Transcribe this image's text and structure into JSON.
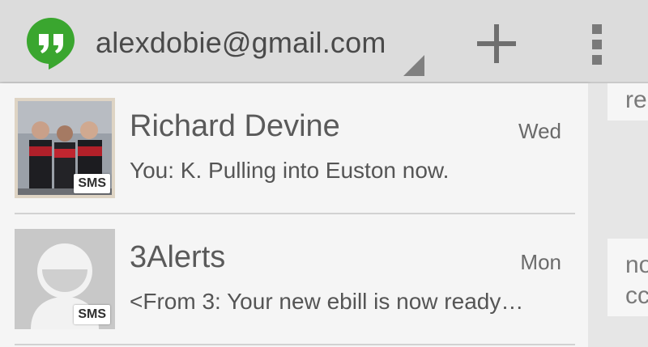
{
  "header": {
    "account_email": "alexdobie@gmail.com",
    "logo_icon": "hangouts-quote-icon",
    "add_icon": "plus-icon",
    "overflow_icon": "overflow-menu-icon",
    "brand_color": "#3aa62f"
  },
  "conversations": [
    {
      "name": "Richard Devine",
      "time": "Wed",
      "snippet": "You: K. Pulling into Euston now.",
      "badge": "SMS",
      "avatar": "contact-photo"
    },
    {
      "name": "3Alerts",
      "time": "Mon",
      "snippet": "<From 3: Your new ebill is now ready…",
      "badge": "SMS",
      "avatar": "default-person-icon"
    }
  ],
  "peek": {
    "lines": [
      "re",
      "no",
      "cc"
    ]
  }
}
